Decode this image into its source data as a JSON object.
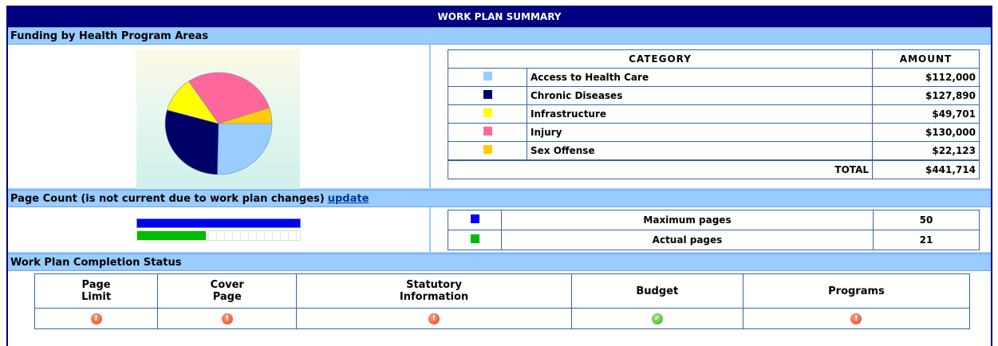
{
  "title": "WORK PLAN SUMMARY",
  "funding": {
    "section_title": "Funding by Health Program Areas",
    "table": {
      "header_category": "CATEGORY",
      "header_amount": "AMOUNT",
      "rows": [
        {
          "label": "Access to Health Care",
          "amount": "$112,000",
          "color": "#99ccff"
        },
        {
          "label": "Chronic Diseases",
          "amount": "$127,890",
          "color": "#000066"
        },
        {
          "label": "Infrastructure",
          "amount": "$49,701",
          "color": "#ffff00"
        },
        {
          "label": "Injury",
          "amount": "$130,000",
          "color": "#ff6699"
        },
        {
          "label": "Sex Offense",
          "amount": "$22,123",
          "color": "#ffcc00"
        }
      ],
      "total_label": "TOTAL",
      "total_amount": "$441,714"
    }
  },
  "chart_data": {
    "type": "pie",
    "categories": [
      "Access to Health Care",
      "Chronic Diseases",
      "Infrastructure",
      "Injury",
      "Sex Offense"
    ],
    "values": [
      112000,
      127890,
      49701,
      130000,
      22123
    ],
    "colors": [
      "#99ccff",
      "#000066",
      "#ffff00",
      "#ff6699",
      "#ffcc00"
    ],
    "title": ""
  },
  "page_count": {
    "section_title": "Page Count (is not current due to work plan changes)",
    "update_link": "update",
    "max_label": "Maximum pages",
    "max_value": "50",
    "max_color": "#0000ee",
    "actual_label": "Actual pages",
    "actual_value": "21",
    "actual_color": "#00bb00",
    "actual_fraction": 0.42
  },
  "completion": {
    "section_title": "Work Plan Completion Status",
    "columns": [
      {
        "line1": "Page",
        "line2": "Limit",
        "status": "warning"
      },
      {
        "line1": "Cover",
        "line2": "Page",
        "status": "warning"
      },
      {
        "line1": "Statutory",
        "line2": "Information",
        "status": "warning"
      },
      {
        "line1": "Budget",
        "line2": "",
        "status": "complete"
      },
      {
        "line1": "Programs",
        "line2": "",
        "status": "warning"
      }
    ]
  }
}
